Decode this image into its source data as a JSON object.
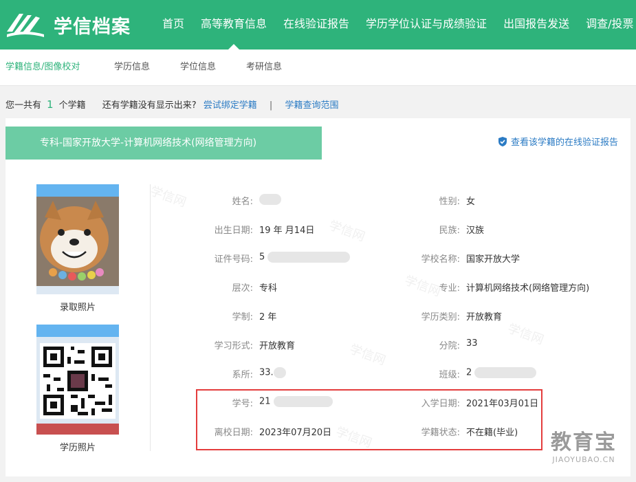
{
  "header": {
    "logo_text": "学信档案",
    "nav": [
      "首页",
      "高等教育信息",
      "在线验证报告",
      "学历学位认证与成绩验证",
      "出国报告发送",
      "调查/投票"
    ]
  },
  "subnav": [
    "学籍信息/图像校对",
    "学历信息",
    "学位信息",
    "考研信息"
  ],
  "summary": {
    "prefix": "您一共有",
    "count": "1",
    "suffix": "个学籍",
    "question": "还有学籍没有显示出来?",
    "link_bind": "尝试绑定学籍",
    "separator": "|",
    "link_scope": "学籍查询范围"
  },
  "record": {
    "title": "专科-国家开放大学-计算机网络技术(网络管理方向)",
    "report_link": "查看该学籍的在线验证报告",
    "photo_admission_label": "录取照片",
    "photo_degree_label": "学历照片",
    "fields_left": [
      {
        "label": "姓名:",
        "value": ""
      },
      {
        "label": "出生日期:",
        "value": "19  年  月14日"
      },
      {
        "label": "证件号码:",
        "value": "5"
      },
      {
        "label": "层次:",
        "value": "专科"
      },
      {
        "label": "学制:",
        "value": "2 年"
      },
      {
        "label": "学习形式:",
        "value": "开放教育"
      },
      {
        "label": "系所:",
        "value": "33."
      },
      {
        "label": "学号:",
        "value": "21"
      },
      {
        "label": "离校日期:",
        "value": "2023年07月20日"
      }
    ],
    "fields_right": [
      {
        "label": "性别:",
        "value": "女"
      },
      {
        "label": "民族:",
        "value": "汉族"
      },
      {
        "label": "学校名称:",
        "value": "国家开放大学"
      },
      {
        "label": "专业:",
        "value": "计算机网络技术(网络管理方向)"
      },
      {
        "label": "学历类别:",
        "value": "开放教育"
      },
      {
        "label": "分院:",
        "value": "33"
      },
      {
        "label": "班级:",
        "value": "2"
      },
      {
        "label": "入学日期:",
        "value": "2021年03月01日"
      },
      {
        "label": "学籍状态:",
        "value": "不在籍(毕业)"
      }
    ]
  },
  "watermark_text": "学信网",
  "corner_logo": {
    "cn": "教育宝",
    "en": "JIAOYUBAO.CN"
  },
  "colors": {
    "brand": "#2eb37b",
    "title_bar": "#6ccca4",
    "link": "#2b7bc4",
    "highlight": "#e43c3c"
  }
}
